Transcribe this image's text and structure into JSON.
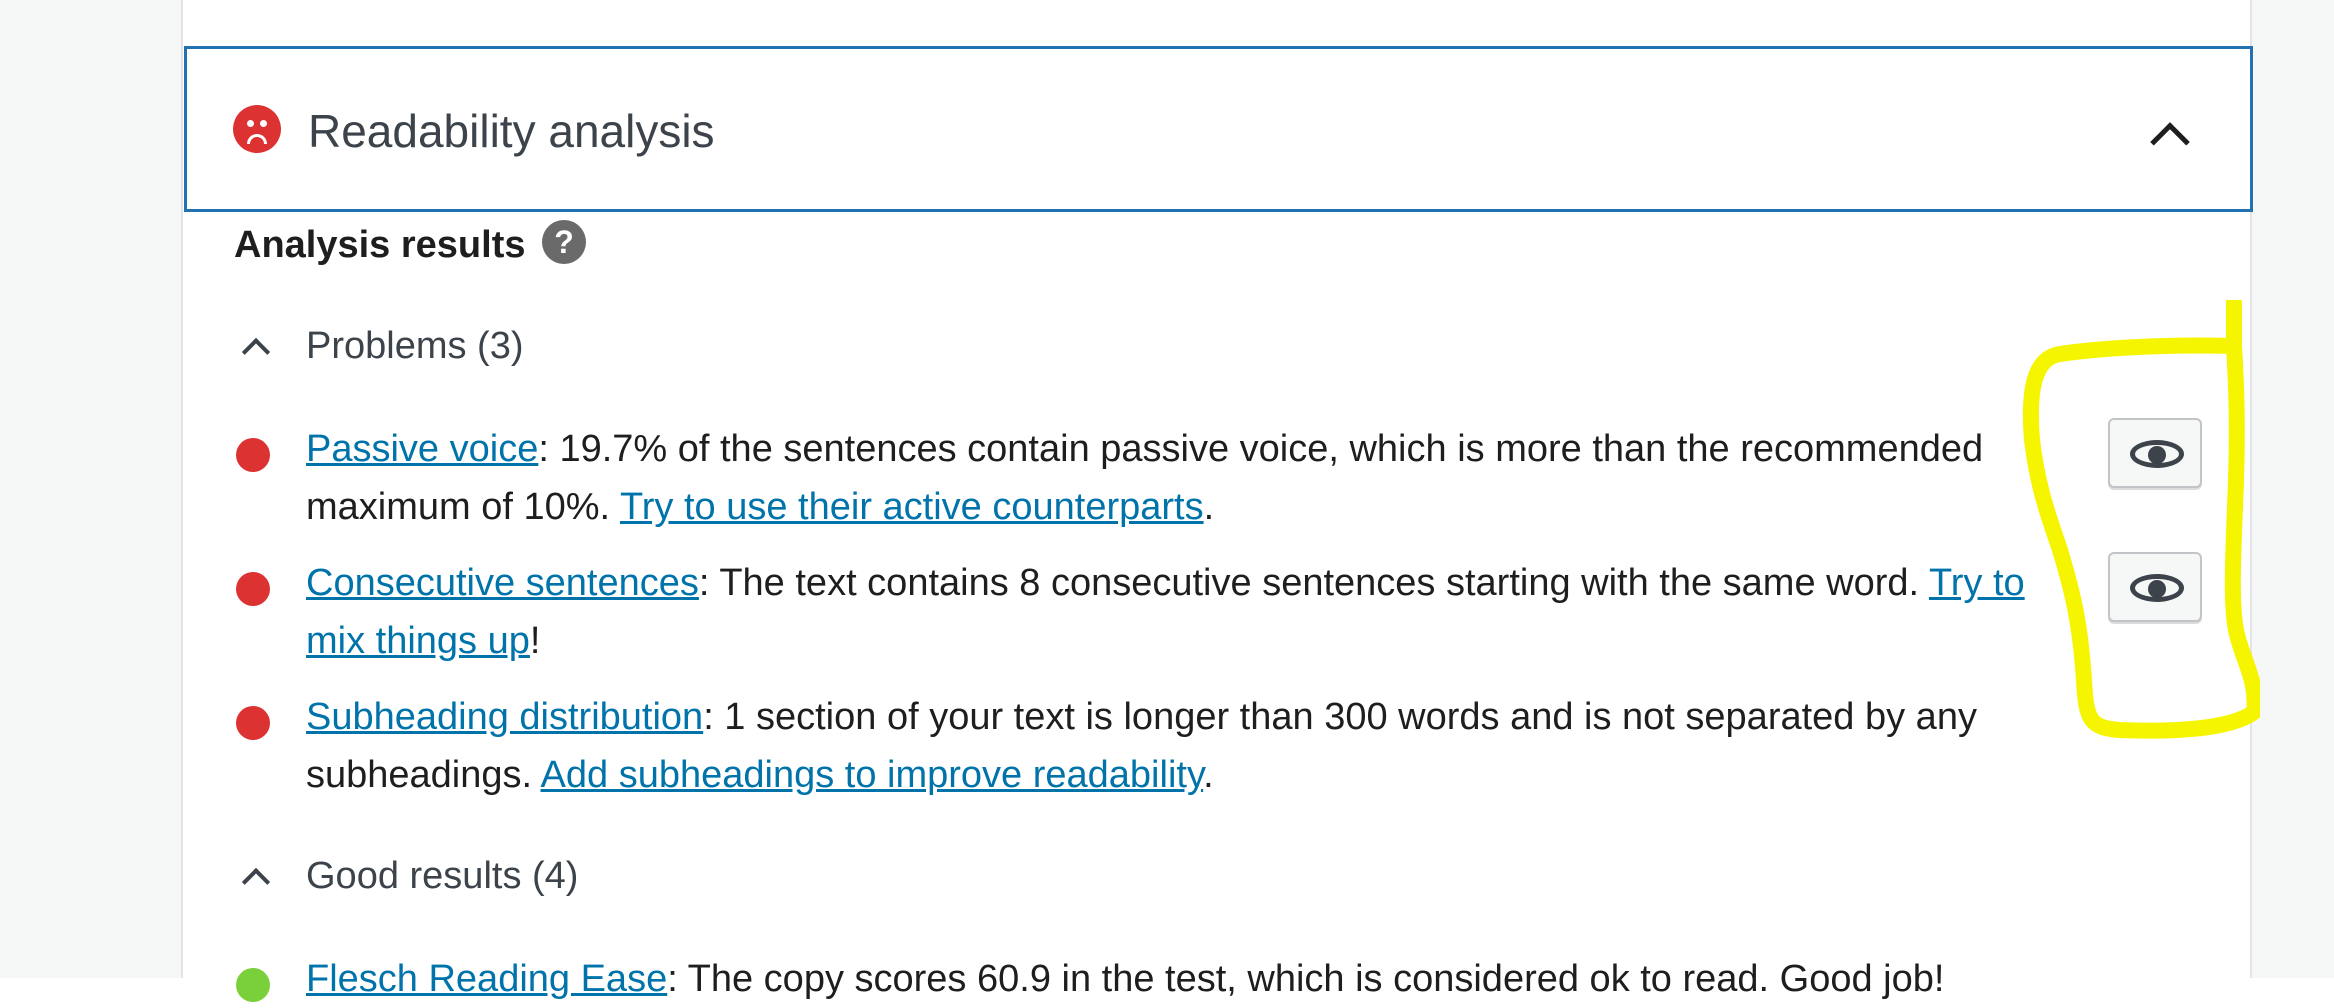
{
  "header": {
    "title": "Readability analysis",
    "status_icon": "sad-face-icon",
    "toggle_icon": "chevron-up-icon"
  },
  "analysis": {
    "title": "Analysis results",
    "help_icon": "question-mark-icon",
    "help_glyph": "?"
  },
  "problems": {
    "label": "Problems (3)",
    "items": [
      {
        "link": "Passive voice",
        "text": ": 19.7% of the sentences contain passive voice, which is more than the recommended maximum of 10%. ",
        "action": "Try to use their active counterparts",
        "end": ".",
        "has_eye": true
      },
      {
        "link": "Consecutive sentences",
        "text": ": The text contains 8 consecutive sentences starting with the same word. ",
        "action": "Try to mix things up",
        "end": "!",
        "has_eye": true
      },
      {
        "link": "Subheading distribution",
        "text": ": 1 section of your text is longer than 300 words and is not separated by any subheadings. ",
        "action": "Add subheadings to improve readability",
        "end": ".",
        "has_eye": false
      }
    ]
  },
  "good": {
    "label": "Good results (4)",
    "items": [
      {
        "link": "Flesch Reading Ease",
        "text": ": The copy scores 60.9 in the test, which is considered ok to read. Good job!"
      }
    ]
  },
  "colors": {
    "accent": "#2271b1",
    "link": "#0073aa",
    "problem": "#dc3232",
    "good": "#7ad03a",
    "highlight": "#f5f500"
  }
}
